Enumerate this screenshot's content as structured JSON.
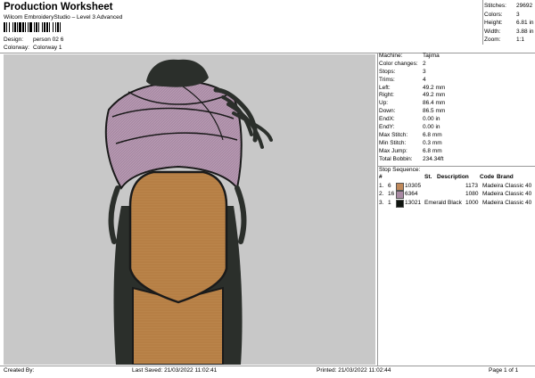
{
  "header": {
    "title": "Production Worksheet",
    "subtitle": "Wilcom EmbroideryStudio – Level 3 Advanced",
    "design_label": "Design:",
    "design_value": "person 02 6",
    "colorway_label": "Colorway:",
    "colorway_value": "Colorway 1"
  },
  "stats": [
    {
      "label": "Stitches:",
      "value": "29692"
    },
    {
      "label": "Colors:",
      "value": "3"
    },
    {
      "label": "Height:",
      "value": "6.81 in"
    },
    {
      "label": "Width:",
      "value": "3.88 in"
    },
    {
      "label": "Zoom:",
      "value": "1:1"
    }
  ],
  "machine_info": [
    {
      "label": "Machine:",
      "value": "Tajima"
    },
    {
      "label": "Color changes:",
      "value": "2"
    },
    {
      "label": "Stops:",
      "value": "3"
    },
    {
      "label": "Trims:",
      "value": "4"
    },
    {
      "label": "Left:",
      "value": "49.2 mm"
    },
    {
      "label": "Right:",
      "value": "49.2 mm"
    },
    {
      "label": "Up:",
      "value": "86.4 mm"
    },
    {
      "label": "Down:",
      "value": "86.5 mm"
    },
    {
      "label": "EndX:",
      "value": "0.00 in"
    },
    {
      "label": "EndY:",
      "value": "0.00 in"
    },
    {
      "label": "Max Stitch:",
      "value": "6.8 mm"
    },
    {
      "label": "Min Stitch:",
      "value": "0.3 mm"
    },
    {
      "label": "Max Jump:",
      "value": "6.8 mm"
    },
    {
      "label": "Total Bobbin:",
      "value": "234.34ft"
    }
  ],
  "stop_sequence": {
    "title": "Stop Sequence:",
    "headers": {
      "number": "#",
      "stitches": "St.",
      "description": "Description",
      "code": "Code",
      "brand": "Brand"
    },
    "rows": [
      {
        "stop": "1.",
        "seq": "6",
        "color": "#c0895a",
        "code_num": "10305",
        "description": "",
        "stitches": "1173",
        "brand": "Madeira Classic 40"
      },
      {
        "stop": "2.",
        "seq": "16",
        "color": "#a98aa4",
        "code_num": "6364",
        "description": "",
        "stitches": "1080",
        "brand": "Madeira Classic 40"
      },
      {
        "stop": "3.",
        "seq": "1",
        "color": "#0f1410",
        "code_num": "13021",
        "description": "Emerald Black",
        "stitches": "1000",
        "brand": "Madeira Classic 40"
      }
    ]
  },
  "footer": {
    "created_by": "Created By:",
    "last_saved": "Last Saved: 21/03/2022 11:02:41",
    "printed": "Printed: 21/03/2022 11:02:44",
    "page": "Page 1 of 1"
  },
  "colors": {
    "canvas_background": "#c8c8c8",
    "skin": "#b67f45",
    "wrap": "#a98aa4",
    "hair": "#2b2f2b"
  }
}
